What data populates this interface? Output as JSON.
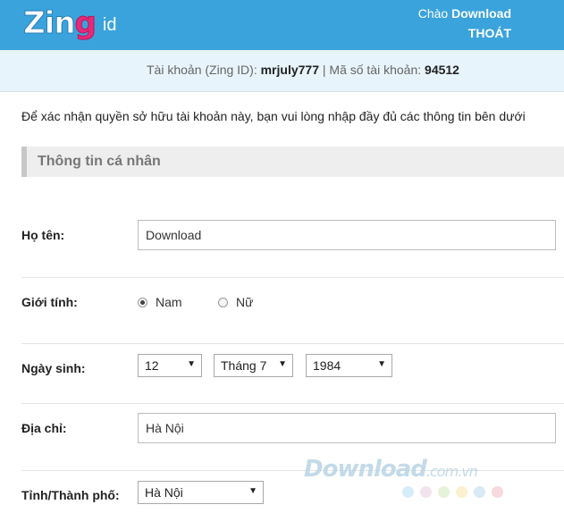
{
  "header": {
    "logo_text": "Zing",
    "logo_suffix": "id",
    "greeting_prefix": "Chào",
    "username": "Download",
    "logout_label": "THOÁT"
  },
  "account": {
    "account_label": "Tài khoản (Zing ID):",
    "account_value": "mrjuly777",
    "separator": "|",
    "number_label": "Mã số tài khoản:",
    "number_value": "94512"
  },
  "intro_text": "Để xác nhận quyền sở hữu tài khoản này, bạn vui lòng nhập đầy đủ các thông tin bên dưới",
  "section_title": "Thông tin cá nhân",
  "form": {
    "name_label": "Họ tên:",
    "name_value": "Download",
    "gender_label": "Giới tính:",
    "gender_options": [
      "Nam",
      "Nữ"
    ],
    "gender_selected": "Nam",
    "dob_label": "Ngày sinh:",
    "dob_day": "12",
    "dob_month": "Tháng 7",
    "dob_year": "1984",
    "address_label": "Địa chỉ:",
    "address_value": "Hà Nội",
    "city_label": "Tỉnh/Thành phố:",
    "city_value": "Hà Nội"
  },
  "watermark": {
    "text": "Download",
    "suffix": ".com.vn",
    "dot_colors": [
      "#d6ecf8",
      "#f3e3ee",
      "#e6f2d9",
      "#fbf0cf",
      "#d9e9f6",
      "#f8d9de"
    ]
  }
}
